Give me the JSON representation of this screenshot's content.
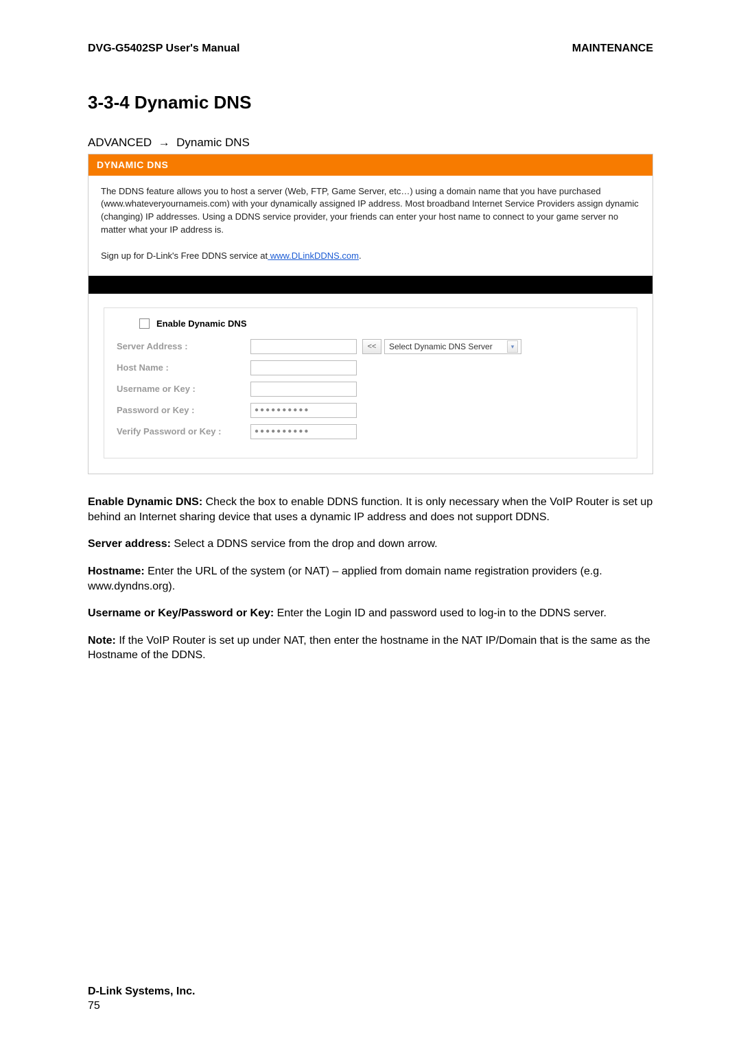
{
  "header": {
    "left": "DVG-G5402SP User's Manual",
    "right": "MAINTENANCE"
  },
  "section": {
    "heading": "3-3-4 Dynamic DNS",
    "breadcrumb_left": "ADVANCED",
    "breadcrumb_arrow": "→",
    "breadcrumb_right": "Dynamic DNS"
  },
  "panel": {
    "title": "DYNAMIC DNS",
    "desc": "The DDNS feature allows you to host a server (Web, FTP, Game Server, etc…) using a domain name that you have purchased (www.whateveryournameis.com) with your dynamically assigned IP address. Most broadband Internet Service Providers assign dynamic (changing) IP addresses. Using a DDNS service provider, your friends can enter your host name to connect to your game server no matter what your IP address is.",
    "signup_prefix": "Sign up for D-Link's Free DDNS service at",
    "signup_link_text": " www.DLinkDDNS.com",
    "signup_suffix": ".",
    "enable_label": "Enable Dynamic DNS",
    "server_address_label": "Server Address :",
    "ltlt": "<<",
    "select_placeholder": "Select Dynamic DNS Server",
    "host_name_label": "Host Name :",
    "username_label": "Username or Key :",
    "password_label": "Password or Key :",
    "verify_label": "Verify Password or Key :",
    "dots": "●●●●●●●●●●"
  },
  "paragraphs": {
    "p1_strong": "Enable Dynamic DNS:",
    "p1": " Check the box to enable DDNS function. It is only necessary when the VoIP Router is set up behind an Internet sharing device that uses a dynamic IP address and does not support DDNS.",
    "p2_strong": "Server address:",
    "p2": " Select a DDNS service from the drop and down arrow.",
    "p3_strong": "Hostname:",
    "p3": " Enter the URL of the system (or NAT) – applied from domain name registration providers (e.g. www.dyndns.org).",
    "p4_strong": "Username or Key/Password or Key:",
    "p4": " Enter the Login ID and password used to log-in to the DDNS server.",
    "p5_strong": "Note:",
    "p5": " If the VoIP Router is set up under NAT, then enter the hostname in the NAT IP/Domain that is the same as the Hostname of the DDNS."
  },
  "footer": {
    "company": "D-Link Systems, Inc.",
    "page": "75"
  }
}
